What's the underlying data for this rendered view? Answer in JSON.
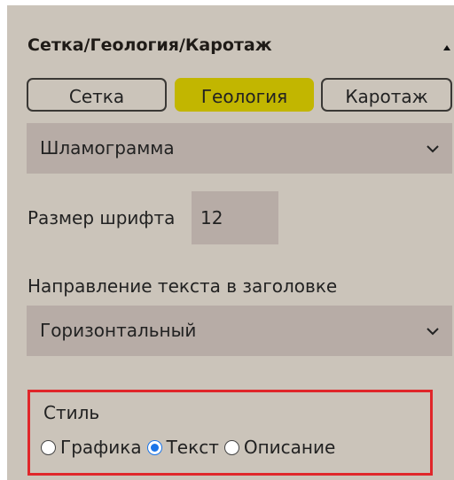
{
  "header": {
    "title": "Сетка/Геология/Каротаж"
  },
  "tabs": [
    {
      "label": "Сетка",
      "active": false
    },
    {
      "label": "Геология",
      "active": true
    },
    {
      "label": "Каротаж",
      "active": false
    }
  ],
  "selects": {
    "mode": {
      "value": "Шламограмма"
    },
    "direction": {
      "value": "Горизонтальный"
    }
  },
  "font_size": {
    "label": "Размер шрифта",
    "value": "12"
  },
  "direction": {
    "label": "Направление текста в заголовке"
  },
  "style": {
    "label": "Стиль",
    "options": [
      {
        "label": "Графика",
        "checked": false
      },
      {
        "label": "Текст",
        "checked": true
      },
      {
        "label": "Описание",
        "checked": false
      }
    ]
  },
  "colors": {
    "panel_bg": "#cbc4ba",
    "field_bg": "#b7aca6",
    "active_tab": "#c2b600",
    "highlight_border": "#e0262a",
    "radio_accent": "#1a74e8"
  }
}
